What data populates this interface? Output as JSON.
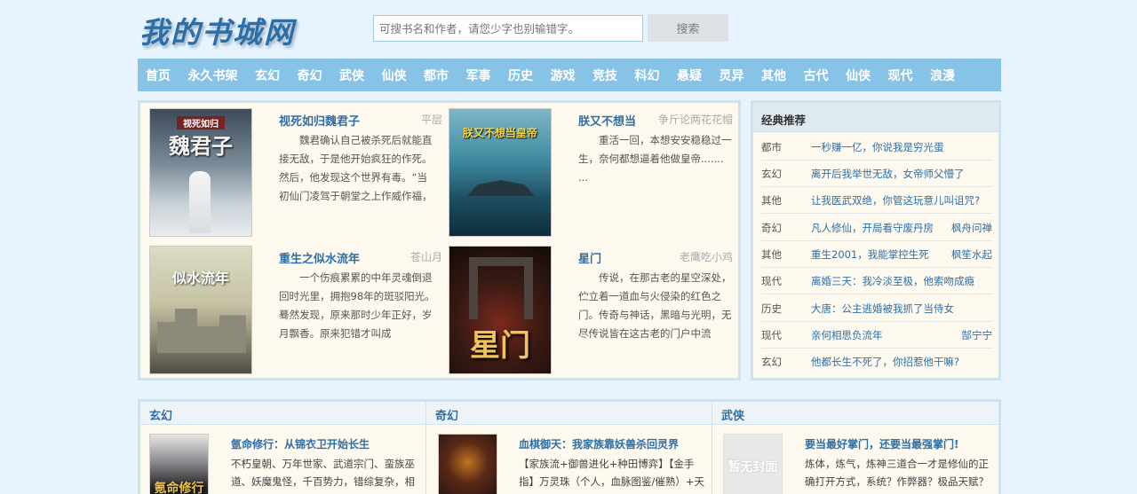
{
  "site": {
    "logo": "我的书城网"
  },
  "search": {
    "placeholder": "可搜书名和作者，请您少字也别输错字。",
    "button": "搜索"
  },
  "nav": [
    "首页",
    "永久书架",
    "玄幻",
    "奇幻",
    "武侠",
    "仙侠",
    "都市",
    "军事",
    "历史",
    "游戏",
    "竞技",
    "科幻",
    "悬疑",
    "灵异",
    "其他",
    "古代",
    "仙侠",
    "现代",
    "浪漫"
  ],
  "featured": [
    {
      "title": "视死如归魏君子",
      "author": "平层",
      "cover_text": "视死如归 魏君子",
      "desc": "魏君确认自己被杀死后就能直接无敌，于是他开始疯狂的作死。然后，他发现这个世界有毒。“当初仙门凌驾于朝堂之上作威作福，"
    },
    {
      "title": "朕又不想当",
      "author": "争斤论两花花帽",
      "cover_text": "朕又不想当皇帝",
      "desc": "重活一回，本想安安稳稳过一生，奈何都想逼着他做皇帝....... ..."
    },
    {
      "title": "重生之似水流年",
      "author": "苍山月",
      "cover_text": "似水流年",
      "desc": "一个伤痕累累的中年灵魂倒退回时光里，拥抱98年的斑驳阳光。蓦然发现，原来那时少年正好，岁月飘香。原来犯错才叫成"
    },
    {
      "title": "星门",
      "author": "老鹰吃小鸡",
      "cover_text": "星门",
      "desc": "传说，在那古老的星空深处，伫立着一道血与火侵染的红色之门。传奇与神话，黑暗与光明，无尽传说皆在这古老的门户中流"
    }
  ],
  "recommend": {
    "title": "经典推荐",
    "rows": [
      {
        "cat": "都市",
        "title": "一秒赚一亿，你说我是穷光蛋",
        "author": ""
      },
      {
        "cat": "玄幻",
        "title": "离开后我举世无敌，女帝师父懵了",
        "author": ""
      },
      {
        "cat": "其他",
        "title": "让我医武双绝，你管这玩意儿叫诅咒?",
        "author": ""
      },
      {
        "cat": "奇幻",
        "title": "凡人修仙，开局看守废丹房",
        "author": "枫舟问禅"
      },
      {
        "cat": "其他",
        "title": "重生2001，我能掌控生死",
        "author": "枫笙水起"
      },
      {
        "cat": "现代",
        "title": "离婚三天：我冷淡至极，他索吻成瘾",
        "author": ""
      },
      {
        "cat": "历史",
        "title": "大唐：公主逃婚被我抓了当侍女",
        "author": ""
      },
      {
        "cat": "现代",
        "title": "亲何相思负流年",
        "author": "郜宁宁"
      },
      {
        "cat": "玄幻",
        "title": "他都长生不死了，你招惹他干嘛?",
        "author": ""
      }
    ]
  },
  "categories": [
    {
      "name": "玄幻",
      "book": "氩命修行：从锦衣卫开始长生",
      "cover_text": "氪命修行",
      "desc": "不朽皇朝、万年世家、武道宗门、蛮族巫道、妖魔鬼怪，千百势力，错综复杂，相互纠缠！陈月，觉醒来，成为大周皇朝的"
    },
    {
      "name": "奇幻",
      "book": "血棋御天：我家族靠妖兽杀回灵界",
      "cover_text": "",
      "desc": "【家族流+御兽进化+种田博弈】【金手指】万灵珠（个人，血脉图鉴/催熟）+天元棋盘（家族，弈局收/回馈）【暂时无"
    },
    {
      "name": "武侠",
      "book": "要当最好掌门，还要当最强掌门!",
      "cover_text": "暂无封面",
      "desc": "炼体，炼气，炼神三道合一才是修仙的正确打开方式，系统？作弊器？极品天赋？我觉我人遗憾了而更，一切修仙皆炼攒发展，我"
    }
  ]
}
